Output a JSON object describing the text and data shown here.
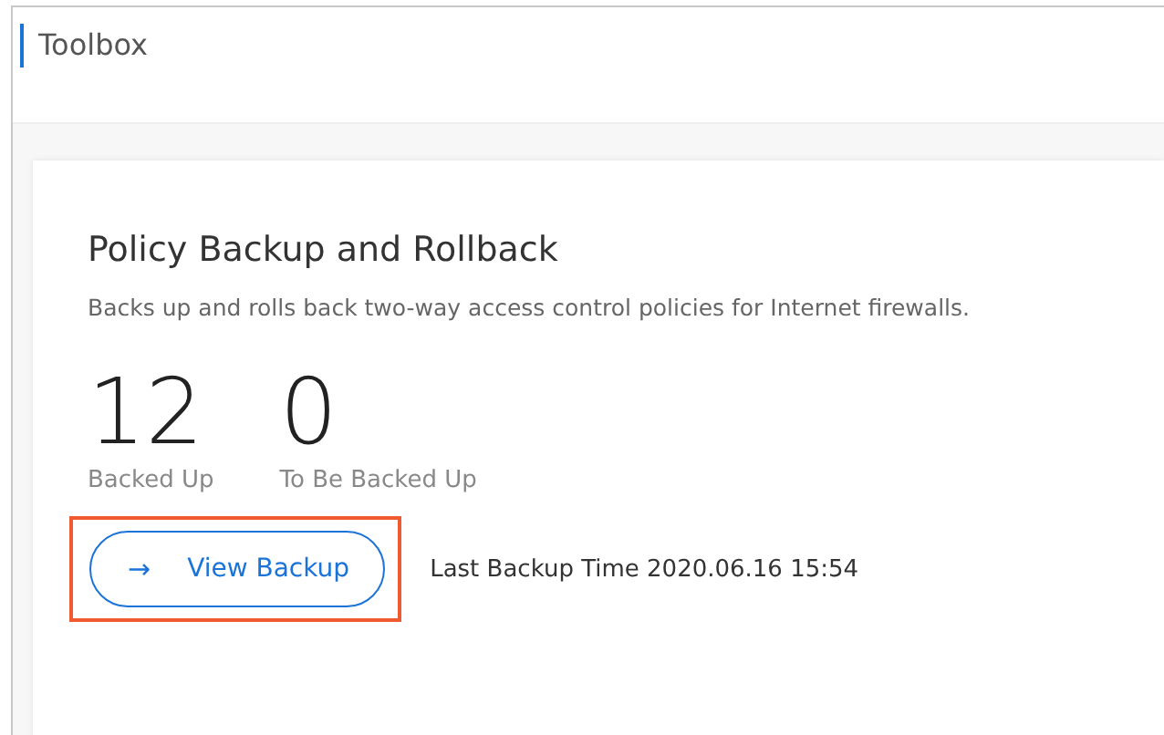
{
  "page": {
    "title": "Toolbox"
  },
  "card": {
    "title": "Policy Backup and Rollback",
    "description": "Backs up and rolls back two-way access control policies for Internet firewalls.",
    "stats": [
      {
        "value": "12",
        "label": "Backed Up"
      },
      {
        "value": "0",
        "label": "To Be Backed Up"
      }
    ],
    "button": {
      "icon": "→",
      "label": "View Backup",
      "highlighted": true
    },
    "last_backup": "Last Backup Time 2020.06.16 15:54"
  }
}
